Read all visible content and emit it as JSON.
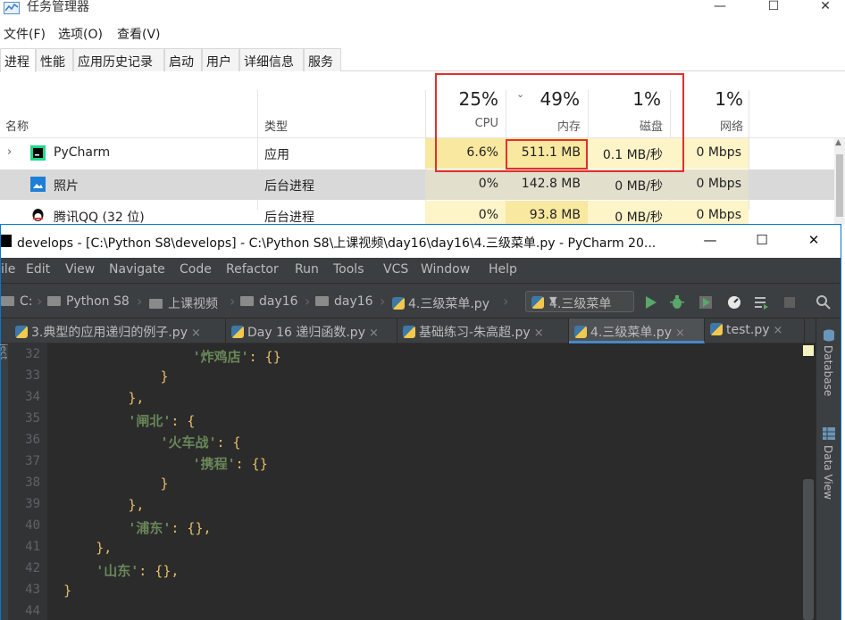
{
  "task_manager": {
    "title": "任务管理器",
    "window_controls": [
      "—",
      "☐",
      "✕"
    ],
    "menu": [
      "文件(F)",
      "选项(O)",
      "查看(V)"
    ],
    "tabs": [
      "进程",
      "性能",
      "应用历史记录",
      "启动",
      "用户",
      "详细信息",
      "服务"
    ],
    "columns": {
      "name": "名称",
      "type": "类型",
      "cpu": {
        "percent": "25%",
        "label": "CPU"
      },
      "memory": {
        "percent": "49%",
        "label": "内存"
      },
      "disk": {
        "percent": "1%",
        "label": "磁盘"
      },
      "network": {
        "percent": "1%",
        "label": "网络"
      }
    },
    "rows": [
      {
        "name": "PyCharm",
        "type": "应用",
        "cpu": "6.6%",
        "memory": "511.1 MB",
        "disk": "0.1 MB/秒",
        "network": "0 Mbps",
        "expand": "›"
      },
      {
        "name": "照片",
        "type": "后台进程",
        "cpu": "0%",
        "memory": "142.8 MB",
        "disk": "0 MB/秒",
        "network": "0 Mbps"
      },
      {
        "name": "腾讯QQ (32 位)",
        "type": "后台进程",
        "cpu": "0%",
        "memory": "93.8 MB",
        "disk": "0 MB/秒",
        "network": "0 Mbps"
      }
    ],
    "colors": {
      "heat_high": "#f9e8a0",
      "heat_low": "#fdf4c8",
      "annotation": "#e03030"
    }
  },
  "pycharm": {
    "title": "develops - [C:\\Python S8\\develops] - C:\\Python S8\\上课视频\\day16\\day16\\4.三级菜单.py - PyCharm 20...",
    "window_controls": [
      "—",
      "☐",
      "✕"
    ],
    "menu": [
      "ile",
      "Edit",
      "View",
      "Navigate",
      "Code",
      "Refactor",
      "Run",
      "Tools",
      "VCS",
      "Window",
      "Help"
    ],
    "breadcrumbs": [
      "C:",
      "Python S8",
      "上课视频",
      "day16",
      "day16",
      "4.三级菜单.py"
    ],
    "run_config": "4.三级菜单",
    "tabs": [
      {
        "label": "3.典型的应用递归的例子.py",
        "close": "×"
      },
      {
        "label": "Day 16 递归函数.py",
        "close": "×"
      },
      {
        "label": "基础练习-朱高超.py",
        "close": "×"
      },
      {
        "label": "4.三级菜单.py",
        "close": "×",
        "active": true
      },
      {
        "label": "test.py",
        "close": "×"
      }
    ],
    "side_panels": [
      "Database",
      "Data View"
    ],
    "left_strip_text": "ject",
    "line_numbers": [
      "32",
      "33",
      "34",
      "35",
      "36",
      "37",
      "38",
      "39",
      "40",
      "41",
      "42",
      "43",
      "44"
    ],
    "code": [
      {
        "indent": "                  ",
        "key": "'炸鸡店'",
        "rest": ": {}"
      },
      {
        "indent": "              ",
        "key": "",
        "rest": "}"
      },
      {
        "indent": "          ",
        "key": "",
        "rest": "},"
      },
      {
        "indent": "          ",
        "key": "'闸北'",
        "rest": ": {"
      },
      {
        "indent": "              ",
        "key": "'火车战'",
        "rest": ": {"
      },
      {
        "indent": "                  ",
        "key": "'携程'",
        "rest": ": {}"
      },
      {
        "indent": "              ",
        "key": "",
        "rest": "}"
      },
      {
        "indent": "          ",
        "key": "",
        "rest": "},"
      },
      {
        "indent": "          ",
        "key": "'浦东'",
        "rest": ": {},"
      },
      {
        "indent": "      ",
        "key": "",
        "rest": "},"
      },
      {
        "indent": "      ",
        "key": "'山东'",
        "rest": ": {},"
      },
      {
        "indent": "  ",
        "key": "",
        "rest": "}"
      },
      {
        "indent": "",
        "key": "",
        "rest": ""
      }
    ]
  }
}
